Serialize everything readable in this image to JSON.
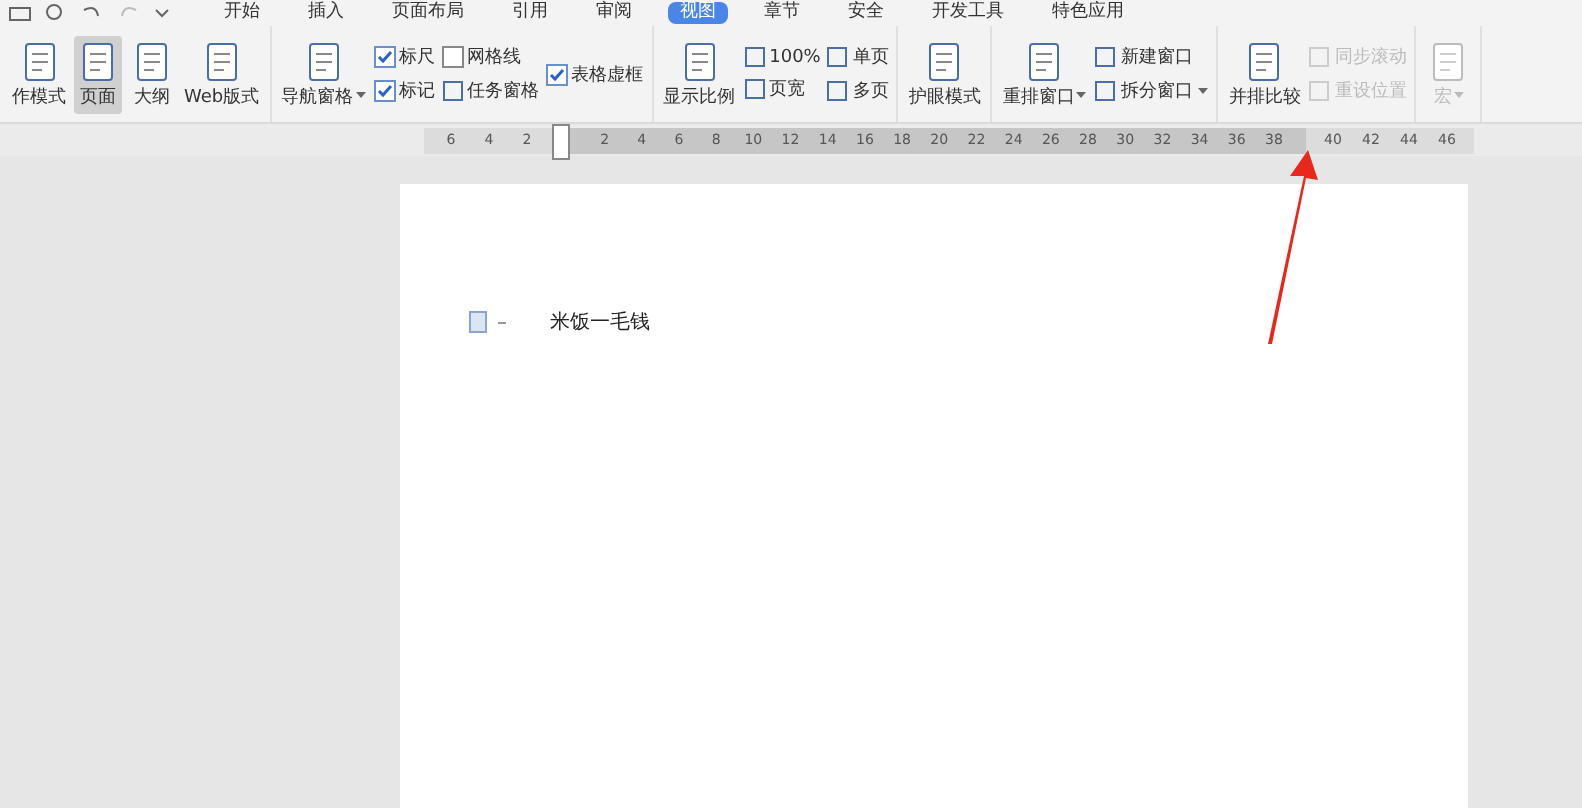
{
  "menu_tabs": [
    {
      "label": "开始",
      "selected": false
    },
    {
      "label": "插入",
      "selected": false
    },
    {
      "label": "页面布局",
      "selected": false
    },
    {
      "label": "引用",
      "selected": false
    },
    {
      "label": "审阅",
      "selected": false
    },
    {
      "label": "视图",
      "selected": true
    },
    {
      "label": "章节",
      "selected": false
    },
    {
      "label": "安全",
      "selected": false
    },
    {
      "label": "开发工具",
      "selected": false
    },
    {
      "label": "特色应用",
      "selected": false
    }
  ],
  "ribbon": [
    {
      "items": [
        {
          "kind": "large",
          "label": "作模式",
          "selected": false
        },
        {
          "kind": "large",
          "label": "页面",
          "selected": true
        },
        {
          "kind": "large",
          "label": "大纲",
          "selected": false
        },
        {
          "kind": "large",
          "label": "Web版式",
          "selected": false
        }
      ]
    },
    {
      "items": [
        {
          "kind": "large",
          "label": "导航窗格",
          "dropdown": true
        },
        {
          "kind": "stack",
          "items": [
            {
              "kind": "check",
              "label": "标尺",
              "checked": true
            },
            {
              "kind": "check",
              "label": "标记",
              "checked": true
            }
          ]
        },
        {
          "kind": "stack",
          "items": [
            {
              "kind": "check",
              "label": "网格线",
              "checked": false
            },
            {
              "kind": "small",
              "label": "任务窗格"
            }
          ]
        },
        {
          "kind": "stack",
          "items": [
            {
              "kind": "check",
              "label": "表格虚框",
              "checked": true
            }
          ]
        }
      ]
    },
    {
      "items": [
        {
          "kind": "large",
          "label": "显示比例"
        },
        {
          "kind": "stack",
          "items": [
            {
              "kind": "small",
              "label": "100%"
            },
            {
              "kind": "small",
              "label": "页宽"
            }
          ]
        },
        {
          "kind": "stack",
          "items": [
            {
              "kind": "small",
              "label": "单页"
            },
            {
              "kind": "small",
              "label": "多页"
            }
          ]
        }
      ]
    },
    {
      "items": [
        {
          "kind": "large",
          "label": "护眼模式"
        }
      ]
    },
    {
      "items": [
        {
          "kind": "large",
          "label": "重排窗口",
          "dropdown": true
        },
        {
          "kind": "stack",
          "items": [
            {
              "kind": "small",
              "label": "新建窗口"
            },
            {
              "kind": "small",
              "label": "拆分窗口",
              "dropdown": true
            }
          ]
        }
      ]
    },
    {
      "items": [
        {
          "kind": "large",
          "label": "并排比较"
        },
        {
          "kind": "stack",
          "items": [
            {
              "kind": "small",
              "label": "同步滚动",
              "disabled": true
            },
            {
              "kind": "small",
              "label": "重设位置",
              "disabled": true
            }
          ]
        }
      ]
    },
    {
      "items": [
        {
          "kind": "large",
          "label": "宏",
          "dropdown": true,
          "disabled": true
        }
      ]
    }
  ],
  "ruler": {
    "left_labels": [
      "6",
      "4",
      "2"
    ],
    "labels": [
      "2",
      "4",
      "6",
      "8",
      "10",
      "12",
      "14",
      "16",
      "18",
      "20",
      "22",
      "24",
      "26",
      "28",
      "30",
      "32",
      "34",
      "36",
      "38"
    ],
    "right_labels": [
      "40",
      "42",
      "44",
      "46"
    ]
  },
  "document": {
    "text": "米饭一毛钱"
  }
}
